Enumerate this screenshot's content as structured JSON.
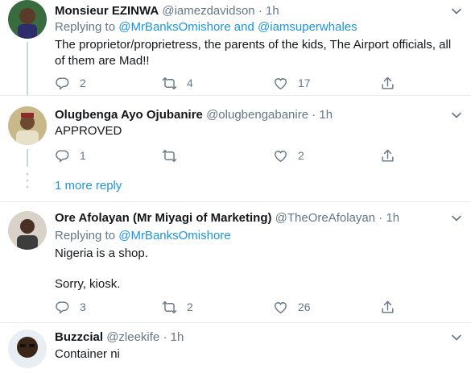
{
  "tweets": [
    {
      "name": "Monsieur EZINWA",
      "handle": "@iamezdavidson",
      "time": "1h",
      "reply_prefix": "Replying to",
      "reply_mentions": "@MrBanksOmishore and @iamsuperwhales",
      "text": "The proprietor/proprietress, the parents of the kids, The Airport officials, all of them are Mad!!",
      "replies": "2",
      "retweets": "4",
      "likes": "17"
    },
    {
      "name": "Olugbenga Ayo Ojubanire",
      "handle": "@olugbengabanire",
      "time": "1h",
      "text": "APPROVED",
      "replies": "1",
      "retweets": "",
      "likes": "2"
    },
    {
      "name": "Ore Afolayan (Mr Miyagi of Marketing)",
      "handle": "@TheOreAfolayan",
      "time": "1h",
      "reply_prefix": "Replying to",
      "reply_mentions": "@MrBanksOmishore",
      "text_line1": "Nigeria is a shop.",
      "text_line2": "Sorry, kiosk.",
      "replies": "3",
      "retweets": "2",
      "likes": "26"
    },
    {
      "name": "Buzzcial",
      "handle": "@zleekife",
      "time": "1h",
      "text": "Container ni"
    }
  ],
  "more_replies": "1 more reply",
  "separator": "·",
  "icons": {
    "reply": "reply-icon",
    "retweet": "retweet-icon",
    "like": "heart-icon",
    "share": "share-icon",
    "more": "chevron-down-icon"
  },
  "colors": {
    "link": "#1b95e0",
    "muted": "#657786",
    "divider": "#e6ecf0"
  }
}
